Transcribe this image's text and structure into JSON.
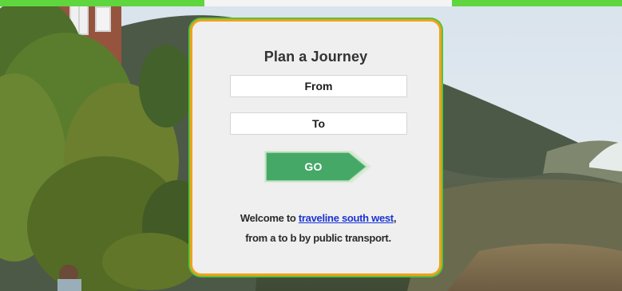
{
  "panel": {
    "title": "Plan a Journey",
    "from_field": "From",
    "to_field": "To",
    "go_button": "GO",
    "welcome_prefix": "Welcome to ",
    "welcome_link": "traveline south west",
    "welcome_suffix": ",",
    "welcome_line2": "from a to b by public transport."
  },
  "colors": {
    "top_strip": "#5fd63d",
    "panel_border": "#f0a21b",
    "panel_outer": "#53c33c",
    "go_button": "#45a867",
    "link": "#1b34d1"
  }
}
